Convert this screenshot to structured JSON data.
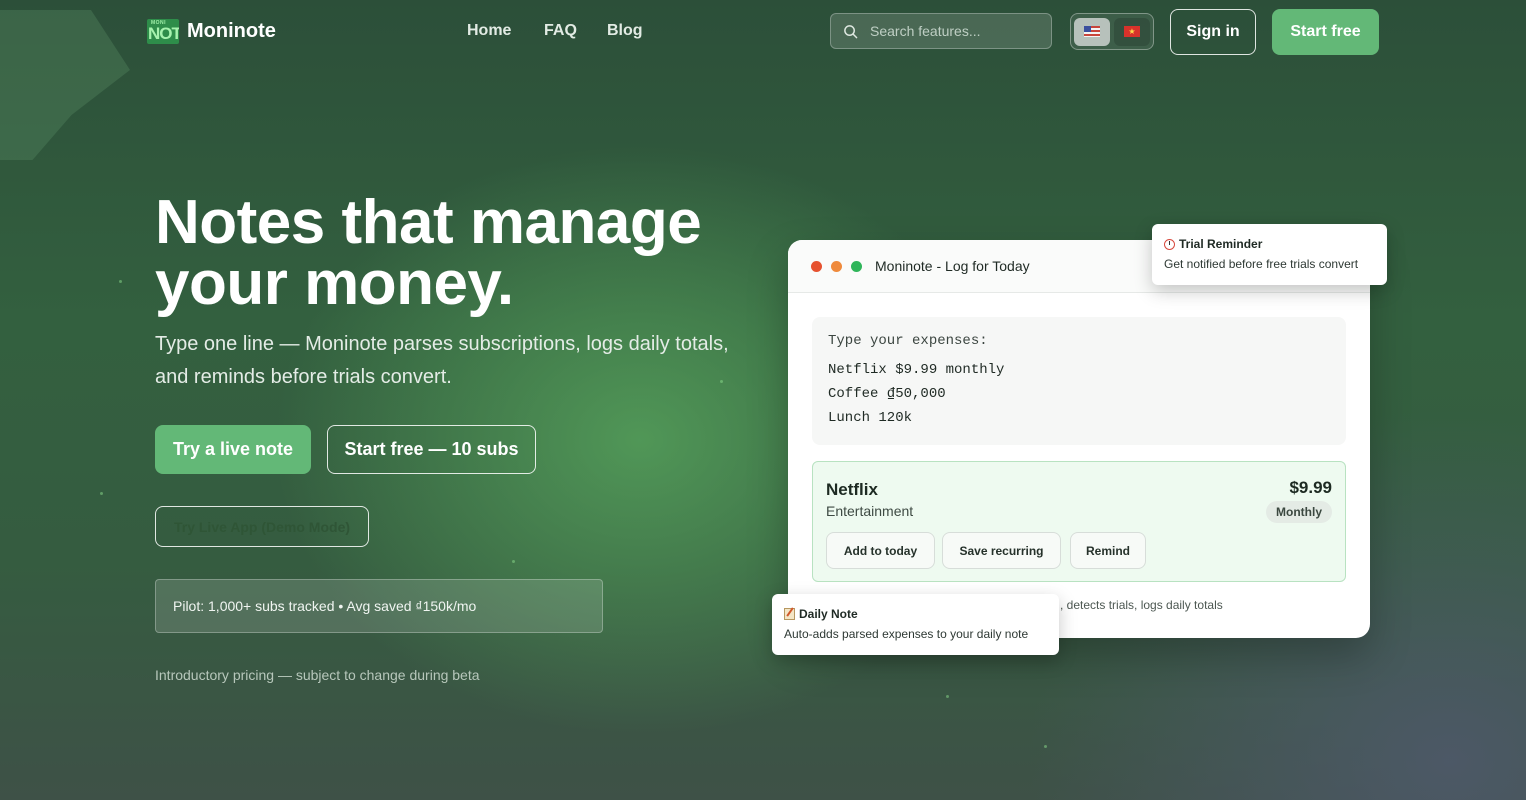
{
  "header": {
    "logo_mark_small": "MONI",
    "logo_mark_big": "NOTE",
    "logo_text": "Moninote",
    "nav": [
      "Home",
      "FAQ",
      "Blog"
    ],
    "search_placeholder": "Search features...",
    "languages": [
      {
        "code": "en",
        "flag": "us-flag-icon",
        "active": true
      },
      {
        "code": "vi",
        "flag": "vn-flag-icon",
        "active": false
      }
    ],
    "sign_in": "Sign in",
    "start_free": "Start free"
  },
  "hero": {
    "title_line1": "Notes that manage",
    "title_line2": "your money.",
    "subtitle": "Type one line — Moninote parses subscriptions, logs daily totals, and reminds before trials convert.",
    "cta_primary": "Try a live note",
    "cta_secondary": "Start free — 10 subs",
    "cta_demo": "Try Live App (Demo Mode)",
    "pilot": "Pilot: 1,000+ subs tracked • Avg saved ₫150k/mo",
    "pricing_note": "Introductory pricing — subject to change during beta"
  },
  "app": {
    "window_title": "Moninote - Log for Today",
    "traffic_lights": [
      "#e6522f",
      "#ef8a3c",
      "#2fb55a"
    ],
    "editor": {
      "placeholder": "Type your expenses:",
      "lines": [
        "Netflix $9.99 monthly",
        "Coffee ₫50,000",
        "Lunch 120k"
      ]
    },
    "subscription": {
      "name": "Netflix",
      "category": "Entertainment",
      "price": "$9.99",
      "period": "Monthly",
      "actions": [
        "Add to today",
        "Save recurring",
        "Remind"
      ]
    },
    "footer_text": ", detects trials, logs daily totals"
  },
  "floats": {
    "trial": {
      "title": "Trial Reminder",
      "desc": "Get notified before free trials convert",
      "icon": "alarm-clock-icon"
    },
    "daily": {
      "title": "Daily Note",
      "desc": "Auto-adds parsed expenses to your daily note",
      "icon": "memo-icon"
    }
  },
  "colors": {
    "accent": "#63b877",
    "card_highlight": "#eefaf0"
  }
}
